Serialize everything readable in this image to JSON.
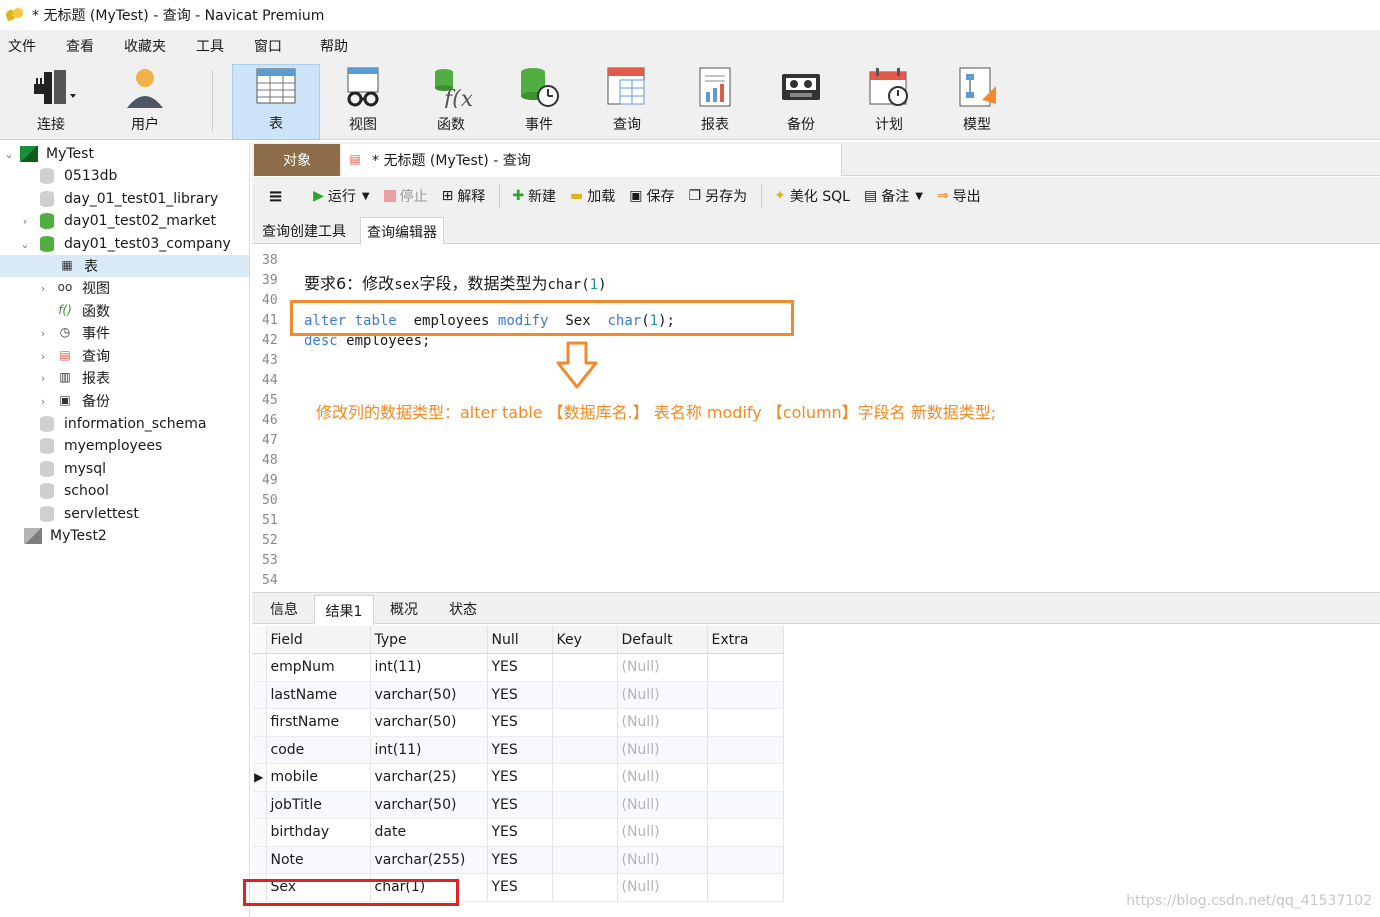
{
  "window": {
    "title": "* 无标题 (MyTest) - 查询 - Navicat Premium"
  },
  "menu": [
    "文件",
    "查看",
    "收藏夹",
    "工具",
    "窗口",
    "帮助"
  ],
  "toolbar": [
    {
      "label": "连接",
      "icon": "plug-icon"
    },
    {
      "label": "用户",
      "icon": "user-icon"
    },
    {
      "label": "表",
      "icon": "table-icon",
      "active": true
    },
    {
      "label": "视图",
      "icon": "view-icon"
    },
    {
      "label": "函数",
      "icon": "function-icon"
    },
    {
      "label": "事件",
      "icon": "event-icon"
    },
    {
      "label": "查询",
      "icon": "query-icon"
    },
    {
      "label": "报表",
      "icon": "report-icon"
    },
    {
      "label": "备份",
      "icon": "backup-icon"
    },
    {
      "label": "计划",
      "icon": "schedule-icon"
    },
    {
      "label": "模型",
      "icon": "model-icon"
    }
  ],
  "tree": [
    {
      "label": "MyTest"
    },
    {
      "label": "0513db"
    },
    {
      "label": "day_01_test01_library"
    },
    {
      "label": "day01_test02_market"
    },
    {
      "label": "day01_test03_company"
    },
    {
      "label": "表"
    },
    {
      "label": "视图"
    },
    {
      "label": "函数"
    },
    {
      "label": "事件"
    },
    {
      "label": "查询"
    },
    {
      "label": "报表"
    },
    {
      "label": "备份"
    },
    {
      "label": "information_schema"
    },
    {
      "label": "myemployees"
    },
    {
      "label": "mysql"
    },
    {
      "label": "school"
    },
    {
      "label": "servlettest"
    },
    {
      "label": "MyTest2"
    }
  ],
  "objtabs": {
    "object": "对象",
    "query": "* 无标题 (MyTest) - 查询"
  },
  "editor_toolbar": {
    "menu": "≡",
    "run": "运行",
    "stop": "停止",
    "explain": "解释",
    "new": "新建",
    "load": "加载",
    "save": "保存",
    "save_as": "另存为",
    "beautify": "美化 SQL",
    "note": "备注",
    "export": "导出"
  },
  "subtabs": [
    "查询创建工具",
    "查询编辑器"
  ],
  "editor": {
    "line_numbers": [
      "38",
      "39",
      "40",
      "41",
      "42",
      "43",
      "44",
      "45",
      "46",
      "47",
      "48",
      "49",
      "50",
      "51",
      "52",
      "53",
      "54"
    ],
    "line39": {
      "prefix": "要求6：修改",
      "mid1": "sex",
      "mid2": "字段，数据类型为",
      "mid3": "char",
      "num": "1"
    },
    "line41": {
      "kw1": "alter",
      "kw2": "table",
      "name": "employees",
      "kw3": "modify",
      "col": "Sex",
      "type": "char",
      "num": "1"
    },
    "line42": {
      "kw": "desc",
      "name": "employees;"
    },
    "note": "修改列的数据类型：alter table  【数据库名.】 表名称  modify  【column】字段名  新数据类型;"
  },
  "result_tabs": [
    "信息",
    "结果1",
    "概况",
    "状态"
  ],
  "grid": {
    "headers": [
      "Field",
      "Type",
      "Null",
      "Key",
      "Default",
      "Extra"
    ],
    "rows": [
      [
        "empNum",
        "int(11)",
        "YES",
        "",
        "(Null)",
        ""
      ],
      [
        "lastName",
        "varchar(50)",
        "YES",
        "",
        "(Null)",
        ""
      ],
      [
        "firstName",
        "varchar(50)",
        "YES",
        "",
        "(Null)",
        ""
      ],
      [
        "code",
        "int(11)",
        "YES",
        "",
        "(Null)",
        ""
      ],
      [
        "mobile",
        "varchar(25)",
        "YES",
        "",
        "(Null)",
        ""
      ],
      [
        "jobTitle",
        "varchar(50)",
        "YES",
        "",
        "(Null)",
        ""
      ],
      [
        "birthday",
        "date",
        "YES",
        "",
        "(Null)",
        ""
      ],
      [
        "Note",
        "varchar(255)",
        "YES",
        "",
        "(Null)",
        ""
      ],
      [
        "Sex",
        "char(1)",
        "YES",
        "",
        "(Null)",
        ""
      ]
    ]
  },
  "watermark": "https://blog.csdn.net/qq_41537102",
  "colors": {
    "accent_orange": "#f2892e",
    "red_box": "#e02222",
    "keyword_blue": "#3c7bd6",
    "object_tab": "#8c6c49"
  }
}
